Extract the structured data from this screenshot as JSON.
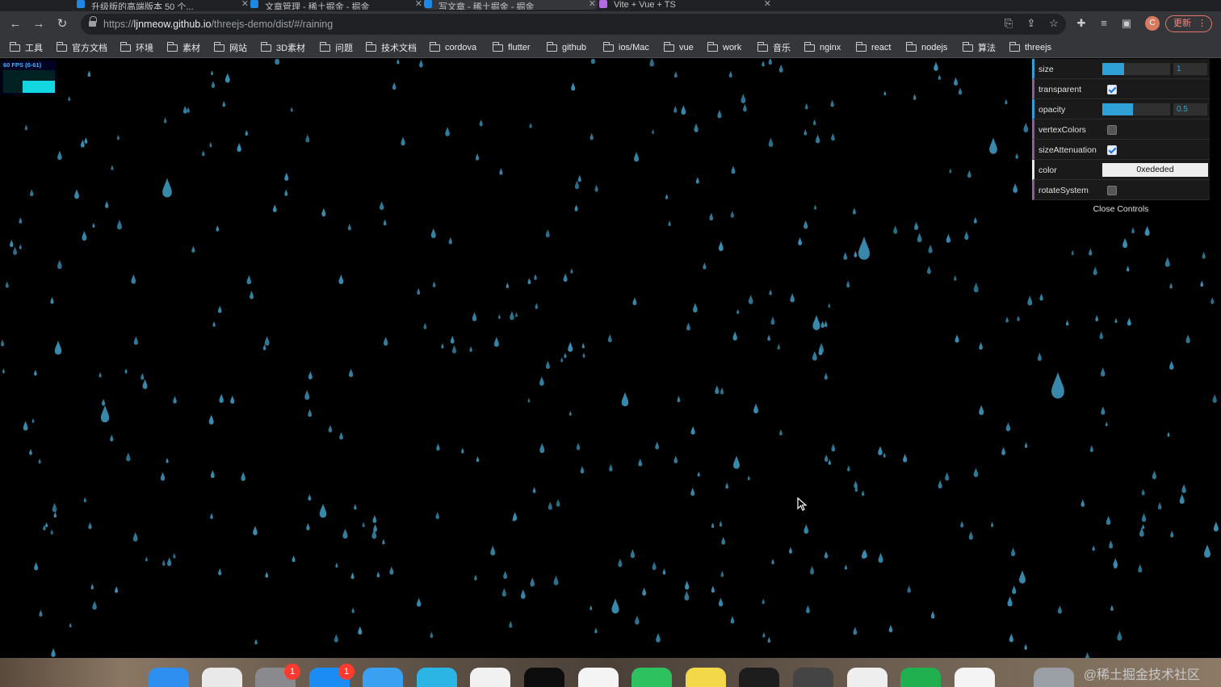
{
  "tabs": [
    {
      "label": "升级版的高端版本 50 个...",
      "active": false
    },
    {
      "label": "文章管理 - 稀土掘金 - 掘金",
      "active": false
    },
    {
      "label": "写文章 - 稀土掘金 - 掘金",
      "active": true
    },
    {
      "label": "Vite + Vue + TS",
      "active": false
    }
  ],
  "toolbar": {
    "back": "←",
    "forward": "→",
    "reload": "↻",
    "url_scheme": "https://",
    "url_host": "ljnmeow.github.io",
    "url_path": "/threejs-demo/dist/#/raining",
    "translate_icon": "⎘",
    "share_icon": "⇪",
    "star_icon": "☆",
    "extensions_icon": "✚",
    "reading_list_icon": "≡",
    "sidepanel_icon": "▣",
    "avatar_letter": "C",
    "update_label": "更新",
    "menu_icon": "⋮"
  },
  "bookmarks": [
    {
      "label": "工具"
    },
    {
      "label": "官方文档"
    },
    {
      "label": "环境"
    },
    {
      "label": "素材"
    },
    {
      "label": "网站"
    },
    {
      "label": "3D素材"
    },
    {
      "label": "问题"
    },
    {
      "label": "技术文档"
    },
    {
      "label": "cordova"
    },
    {
      "label": "flutter"
    },
    {
      "label": "github"
    },
    {
      "label": "ios/Mac"
    },
    {
      "label": "vue"
    },
    {
      "label": "work"
    },
    {
      "label": "音乐"
    },
    {
      "label": "nginx"
    },
    {
      "label": "react"
    },
    {
      "label": "nodejs"
    },
    {
      "label": "算法"
    },
    {
      "label": "threejs"
    }
  ],
  "stats": {
    "text": "60 FPS (0-61)",
    "level": 0.55
  },
  "gui": {
    "size": {
      "label": "size",
      "value": "1",
      "fill": 0.32
    },
    "transparent": {
      "label": "transparent",
      "checked": true
    },
    "opacity": {
      "label": "opacity",
      "value": "0.5",
      "fill": 0.45
    },
    "vertexColors": {
      "label": "vertexColors",
      "checked": false
    },
    "sizeAttenuation": {
      "label": "sizeAttenuation",
      "checked": true
    },
    "color": {
      "label": "color",
      "value": "0xededed"
    },
    "rotateSystem": {
      "label": "rotateSystem",
      "checked": false
    },
    "close": "Close Controls"
  },
  "dock": {
    "apps": [
      {
        "name": "finder",
        "color": "#2f8ff0"
      },
      {
        "name": "launchpad",
        "color": "#e9e9ea"
      },
      {
        "name": "system-preferences",
        "color": "#8a8a8e",
        "badge": "1"
      },
      {
        "name": "app-store",
        "color": "#1c8cf5",
        "badge": "1"
      },
      {
        "name": "safari",
        "color": "#3aa1f2"
      },
      {
        "name": "edge",
        "color": "#2bb5e5"
      },
      {
        "name": "chrome",
        "color": "#f1f1f1"
      },
      {
        "name": "github-desktop",
        "color": "#0d0d0d"
      },
      {
        "name": "qq",
        "color": "#f4f4f4"
      },
      {
        "name": "wechat",
        "color": "#2dc160"
      },
      {
        "name": "maps",
        "color": "#f3d84a"
      },
      {
        "name": "terminal",
        "color": "#1d1d1d"
      },
      {
        "name": "blender",
        "color": "#444"
      },
      {
        "name": "vscode",
        "color": "#eeeeee"
      },
      {
        "name": "hbuilder",
        "color": "#20b050"
      },
      {
        "name": "wechat-devtools",
        "color": "#f4f4f4"
      },
      {
        "name": "trash",
        "color": "#9aa0a6"
      }
    ],
    "watermark": "@稀土掘金技术社区"
  },
  "colors": {
    "raindrop": "#3a8fb4",
    "gui_accent": "#2fa1d6",
    "background": "#000000"
  }
}
